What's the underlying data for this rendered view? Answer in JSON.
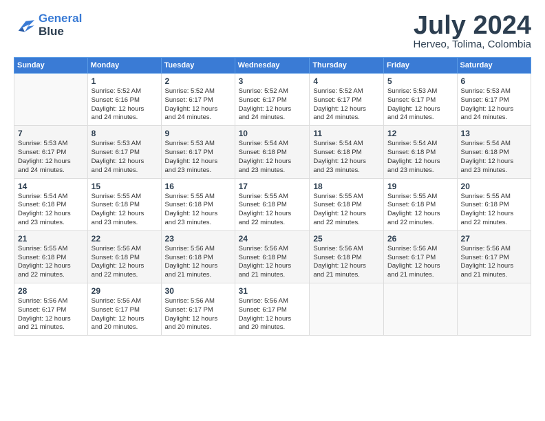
{
  "header": {
    "logo_line1": "General",
    "logo_line2": "Blue",
    "month_year": "July 2024",
    "location": "Herveo, Tolima, Colombia"
  },
  "weekdays": [
    "Sunday",
    "Monday",
    "Tuesday",
    "Wednesday",
    "Thursday",
    "Friday",
    "Saturday"
  ],
  "weeks": [
    [
      {
        "day": "",
        "info": ""
      },
      {
        "day": "1",
        "info": "Sunrise: 5:52 AM\nSunset: 6:16 PM\nDaylight: 12 hours\nand 24 minutes."
      },
      {
        "day": "2",
        "info": "Sunrise: 5:52 AM\nSunset: 6:17 PM\nDaylight: 12 hours\nand 24 minutes."
      },
      {
        "day": "3",
        "info": "Sunrise: 5:52 AM\nSunset: 6:17 PM\nDaylight: 12 hours\nand 24 minutes."
      },
      {
        "day": "4",
        "info": "Sunrise: 5:52 AM\nSunset: 6:17 PM\nDaylight: 12 hours\nand 24 minutes."
      },
      {
        "day": "5",
        "info": "Sunrise: 5:53 AM\nSunset: 6:17 PM\nDaylight: 12 hours\nand 24 minutes."
      },
      {
        "day": "6",
        "info": "Sunrise: 5:53 AM\nSunset: 6:17 PM\nDaylight: 12 hours\nand 24 minutes."
      }
    ],
    [
      {
        "day": "7",
        "info": "Sunrise: 5:53 AM\nSunset: 6:17 PM\nDaylight: 12 hours\nand 24 minutes."
      },
      {
        "day": "8",
        "info": "Sunrise: 5:53 AM\nSunset: 6:17 PM\nDaylight: 12 hours\nand 24 minutes."
      },
      {
        "day": "9",
        "info": "Sunrise: 5:53 AM\nSunset: 6:17 PM\nDaylight: 12 hours\nand 23 minutes."
      },
      {
        "day": "10",
        "info": "Sunrise: 5:54 AM\nSunset: 6:18 PM\nDaylight: 12 hours\nand 23 minutes."
      },
      {
        "day": "11",
        "info": "Sunrise: 5:54 AM\nSunset: 6:18 PM\nDaylight: 12 hours\nand 23 minutes."
      },
      {
        "day": "12",
        "info": "Sunrise: 5:54 AM\nSunset: 6:18 PM\nDaylight: 12 hours\nand 23 minutes."
      },
      {
        "day": "13",
        "info": "Sunrise: 5:54 AM\nSunset: 6:18 PM\nDaylight: 12 hours\nand 23 minutes."
      }
    ],
    [
      {
        "day": "14",
        "info": "Sunrise: 5:54 AM\nSunset: 6:18 PM\nDaylight: 12 hours\nand 23 minutes."
      },
      {
        "day": "15",
        "info": "Sunrise: 5:55 AM\nSunset: 6:18 PM\nDaylight: 12 hours\nand 23 minutes."
      },
      {
        "day": "16",
        "info": "Sunrise: 5:55 AM\nSunset: 6:18 PM\nDaylight: 12 hours\nand 23 minutes."
      },
      {
        "day": "17",
        "info": "Sunrise: 5:55 AM\nSunset: 6:18 PM\nDaylight: 12 hours\nand 22 minutes."
      },
      {
        "day": "18",
        "info": "Sunrise: 5:55 AM\nSunset: 6:18 PM\nDaylight: 12 hours\nand 22 minutes."
      },
      {
        "day": "19",
        "info": "Sunrise: 5:55 AM\nSunset: 6:18 PM\nDaylight: 12 hours\nand 22 minutes."
      },
      {
        "day": "20",
        "info": "Sunrise: 5:55 AM\nSunset: 6:18 PM\nDaylight: 12 hours\nand 22 minutes."
      }
    ],
    [
      {
        "day": "21",
        "info": "Sunrise: 5:55 AM\nSunset: 6:18 PM\nDaylight: 12 hours\nand 22 minutes."
      },
      {
        "day": "22",
        "info": "Sunrise: 5:56 AM\nSunset: 6:18 PM\nDaylight: 12 hours\nand 22 minutes."
      },
      {
        "day": "23",
        "info": "Sunrise: 5:56 AM\nSunset: 6:18 PM\nDaylight: 12 hours\nand 21 minutes."
      },
      {
        "day": "24",
        "info": "Sunrise: 5:56 AM\nSunset: 6:18 PM\nDaylight: 12 hours\nand 21 minutes."
      },
      {
        "day": "25",
        "info": "Sunrise: 5:56 AM\nSunset: 6:18 PM\nDaylight: 12 hours\nand 21 minutes."
      },
      {
        "day": "26",
        "info": "Sunrise: 5:56 AM\nSunset: 6:17 PM\nDaylight: 12 hours\nand 21 minutes."
      },
      {
        "day": "27",
        "info": "Sunrise: 5:56 AM\nSunset: 6:17 PM\nDaylight: 12 hours\nand 21 minutes."
      }
    ],
    [
      {
        "day": "28",
        "info": "Sunrise: 5:56 AM\nSunset: 6:17 PM\nDaylight: 12 hours\nand 21 minutes."
      },
      {
        "day": "29",
        "info": "Sunrise: 5:56 AM\nSunset: 6:17 PM\nDaylight: 12 hours\nand 20 minutes."
      },
      {
        "day": "30",
        "info": "Sunrise: 5:56 AM\nSunset: 6:17 PM\nDaylight: 12 hours\nand 20 minutes."
      },
      {
        "day": "31",
        "info": "Sunrise: 5:56 AM\nSunset: 6:17 PM\nDaylight: 12 hours\nand 20 minutes."
      },
      {
        "day": "",
        "info": ""
      },
      {
        "day": "",
        "info": ""
      },
      {
        "day": "",
        "info": ""
      }
    ]
  ]
}
